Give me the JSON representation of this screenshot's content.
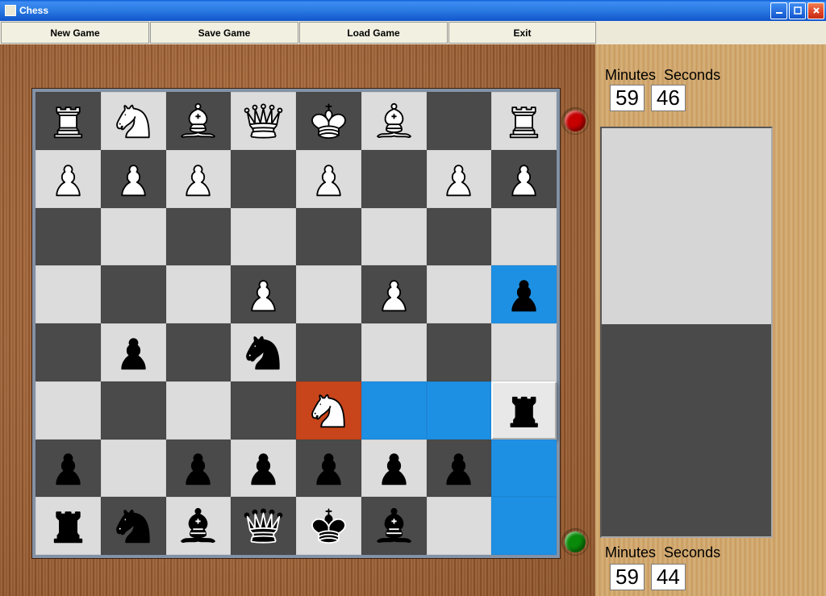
{
  "window": {
    "title": "Chess"
  },
  "toolbar": {
    "new_game": "New Game",
    "save_game": "Save Game",
    "load_game": "Load Game",
    "exit": "Exit"
  },
  "clocks": {
    "minutes_label": "Minutes",
    "seconds_label": "Seconds",
    "top": {
      "minutes": "59",
      "seconds": "46"
    },
    "bottom": {
      "minutes": "59",
      "seconds": "44"
    }
  },
  "turn": {
    "top_color": "red",
    "bottom_color": "green"
  },
  "board": {
    "highlights": {
      "orange": [
        "e3"
      ],
      "blue": [
        "h5",
        "f3",
        "g3",
        "h2",
        "h1"
      ],
      "raised": [
        "h3"
      ]
    },
    "pieces": [
      {
        "sq": "a8",
        "type": "rook",
        "color": "white"
      },
      {
        "sq": "b8",
        "type": "knight",
        "color": "white"
      },
      {
        "sq": "c8",
        "type": "bishop",
        "color": "white"
      },
      {
        "sq": "d8",
        "type": "queen",
        "color": "white"
      },
      {
        "sq": "e8",
        "type": "king",
        "color": "white"
      },
      {
        "sq": "f8",
        "type": "bishop",
        "color": "white"
      },
      {
        "sq": "h8",
        "type": "rook",
        "color": "white"
      },
      {
        "sq": "a7",
        "type": "pawn",
        "color": "white"
      },
      {
        "sq": "b7",
        "type": "pawn",
        "color": "white"
      },
      {
        "sq": "c7",
        "type": "pawn",
        "color": "white"
      },
      {
        "sq": "e7",
        "type": "pawn",
        "color": "white"
      },
      {
        "sq": "g7",
        "type": "pawn",
        "color": "white"
      },
      {
        "sq": "h7",
        "type": "pawn",
        "color": "white"
      },
      {
        "sq": "d5",
        "type": "pawn",
        "color": "white"
      },
      {
        "sq": "f5",
        "type": "pawn",
        "color": "white"
      },
      {
        "sq": "h5",
        "type": "pawn",
        "color": "black"
      },
      {
        "sq": "b4",
        "type": "pawn",
        "color": "black"
      },
      {
        "sq": "d4",
        "type": "knight",
        "color": "black"
      },
      {
        "sq": "e3",
        "type": "knight",
        "color": "white"
      },
      {
        "sq": "h3",
        "type": "rook",
        "color": "black"
      },
      {
        "sq": "a2",
        "type": "pawn",
        "color": "black"
      },
      {
        "sq": "c2",
        "type": "pawn",
        "color": "black"
      },
      {
        "sq": "d2",
        "type": "pawn",
        "color": "black"
      },
      {
        "sq": "e2",
        "type": "pawn",
        "color": "black"
      },
      {
        "sq": "f2",
        "type": "pawn",
        "color": "black"
      },
      {
        "sq": "g2",
        "type": "pawn",
        "color": "black"
      },
      {
        "sq": "a1",
        "type": "rook",
        "color": "black"
      },
      {
        "sq": "b1",
        "type": "knight",
        "color": "black"
      },
      {
        "sq": "c1",
        "type": "bishop",
        "color": "black"
      },
      {
        "sq": "d1",
        "type": "queen",
        "color": "black"
      },
      {
        "sq": "e1",
        "type": "king",
        "color": "black"
      },
      {
        "sq": "f1",
        "type": "bishop",
        "color": "black"
      }
    ]
  }
}
